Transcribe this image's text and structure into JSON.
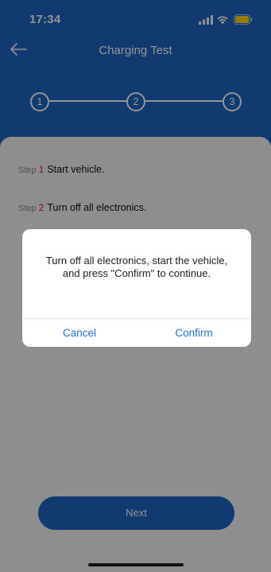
{
  "status_bar": {
    "time": "17:34"
  },
  "nav": {
    "title": "Charging Test",
    "back_icon": "arrow-left-icon"
  },
  "stepper": {
    "steps": [
      "1",
      "2",
      "3"
    ]
  },
  "steps": [
    {
      "word": "Step",
      "num": "1",
      "text": "Start vehicle."
    },
    {
      "word": "Step",
      "num": "2",
      "text": "Turn off all electronics."
    }
  ],
  "next_button": {
    "label": "Next"
  },
  "dialog": {
    "message": "Turn off all electronics, start the vehicle, and press \"Confirm\" to continue.",
    "cancel_label": "Cancel",
    "confirm_label": "Confirm"
  },
  "colors": {
    "primary": "#1e64c2",
    "step_number": "#e02020",
    "dialog_button": "#1e6fd0",
    "battery": "#ffd60a"
  }
}
